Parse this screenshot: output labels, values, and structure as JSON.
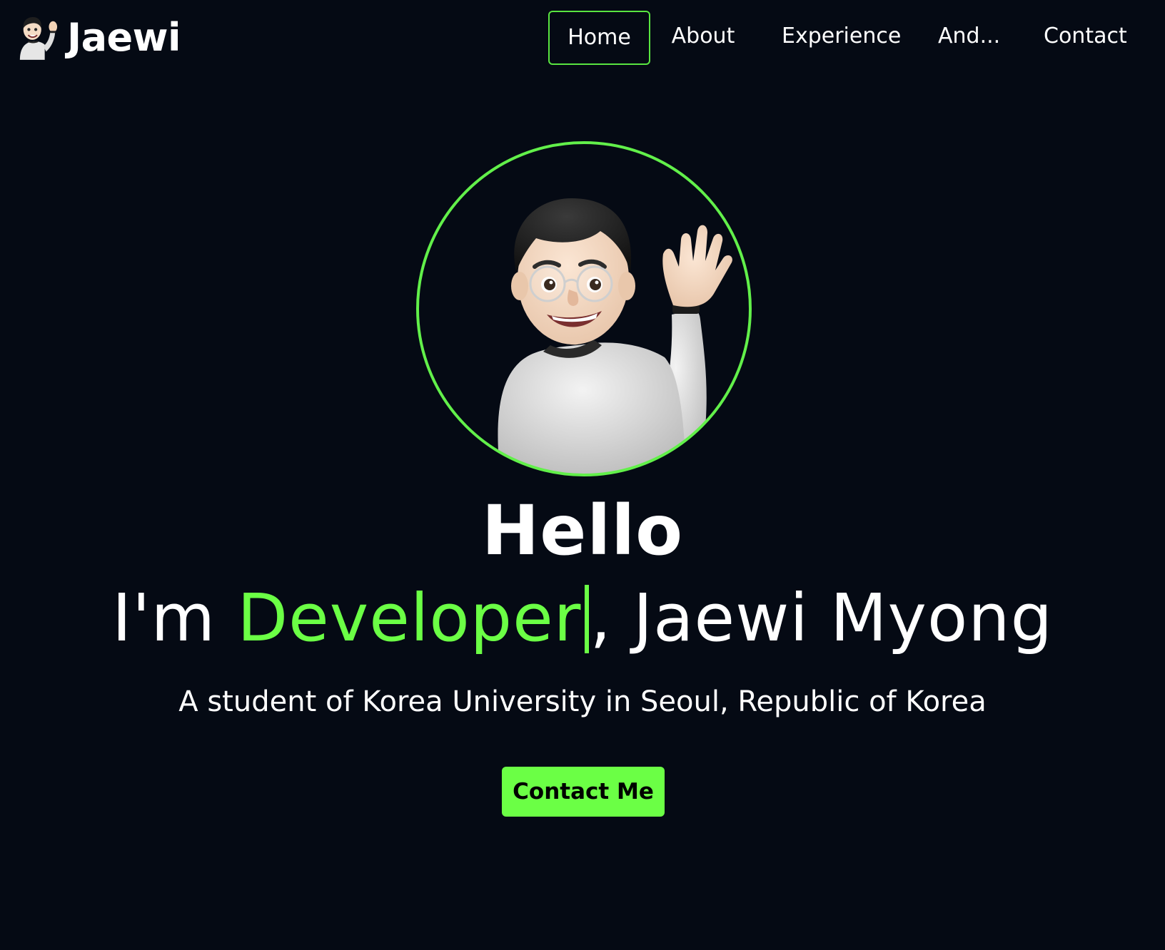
{
  "brand": {
    "name": "Jaewi"
  },
  "nav": {
    "items": [
      {
        "label": "Home",
        "active": true
      },
      {
        "label": "About",
        "active": false
      },
      {
        "label": "Experience",
        "active": false
      },
      {
        "label": "And...",
        "active": false
      },
      {
        "label": "Contact",
        "active": false
      }
    ]
  },
  "hero": {
    "greeting": "Hello",
    "intro_prefix": "I'm ",
    "typed_role": "Developer",
    "intro_suffix": ", Jaewi Myong",
    "subtitle": "A student of Korea University in Seoul, Republic of Korea",
    "cta_label": "Contact Me"
  },
  "colors": {
    "background": "#050a14",
    "accent": "#6bff45",
    "text": "#ffffff"
  },
  "icons": {
    "brand_avatar": "waving-memoji-avatar-icon",
    "hero_avatar": "waving-memoji-avatar"
  }
}
